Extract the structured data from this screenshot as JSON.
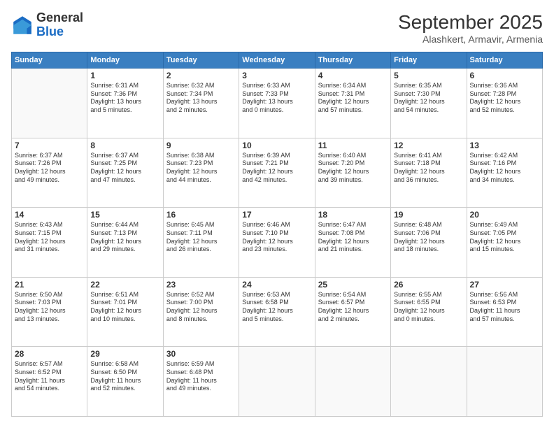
{
  "header": {
    "logo_general": "General",
    "logo_blue": "Blue",
    "month_title": "September 2025",
    "subtitle": "Alashkert, Armavir, Armenia"
  },
  "days_of_week": [
    "Sunday",
    "Monday",
    "Tuesday",
    "Wednesday",
    "Thursday",
    "Friday",
    "Saturday"
  ],
  "weeks": [
    [
      {
        "day": "",
        "info": ""
      },
      {
        "day": "1",
        "info": "Sunrise: 6:31 AM\nSunset: 7:36 PM\nDaylight: 13 hours\nand 5 minutes."
      },
      {
        "day": "2",
        "info": "Sunrise: 6:32 AM\nSunset: 7:34 PM\nDaylight: 13 hours\nand 2 minutes."
      },
      {
        "day": "3",
        "info": "Sunrise: 6:33 AM\nSunset: 7:33 PM\nDaylight: 13 hours\nand 0 minutes."
      },
      {
        "day": "4",
        "info": "Sunrise: 6:34 AM\nSunset: 7:31 PM\nDaylight: 12 hours\nand 57 minutes."
      },
      {
        "day": "5",
        "info": "Sunrise: 6:35 AM\nSunset: 7:30 PM\nDaylight: 12 hours\nand 54 minutes."
      },
      {
        "day": "6",
        "info": "Sunrise: 6:36 AM\nSunset: 7:28 PM\nDaylight: 12 hours\nand 52 minutes."
      }
    ],
    [
      {
        "day": "7",
        "info": "Sunrise: 6:37 AM\nSunset: 7:26 PM\nDaylight: 12 hours\nand 49 minutes."
      },
      {
        "day": "8",
        "info": "Sunrise: 6:37 AM\nSunset: 7:25 PM\nDaylight: 12 hours\nand 47 minutes."
      },
      {
        "day": "9",
        "info": "Sunrise: 6:38 AM\nSunset: 7:23 PM\nDaylight: 12 hours\nand 44 minutes."
      },
      {
        "day": "10",
        "info": "Sunrise: 6:39 AM\nSunset: 7:21 PM\nDaylight: 12 hours\nand 42 minutes."
      },
      {
        "day": "11",
        "info": "Sunrise: 6:40 AM\nSunset: 7:20 PM\nDaylight: 12 hours\nand 39 minutes."
      },
      {
        "day": "12",
        "info": "Sunrise: 6:41 AM\nSunset: 7:18 PM\nDaylight: 12 hours\nand 36 minutes."
      },
      {
        "day": "13",
        "info": "Sunrise: 6:42 AM\nSunset: 7:16 PM\nDaylight: 12 hours\nand 34 minutes."
      }
    ],
    [
      {
        "day": "14",
        "info": "Sunrise: 6:43 AM\nSunset: 7:15 PM\nDaylight: 12 hours\nand 31 minutes."
      },
      {
        "day": "15",
        "info": "Sunrise: 6:44 AM\nSunset: 7:13 PM\nDaylight: 12 hours\nand 29 minutes."
      },
      {
        "day": "16",
        "info": "Sunrise: 6:45 AM\nSunset: 7:11 PM\nDaylight: 12 hours\nand 26 minutes."
      },
      {
        "day": "17",
        "info": "Sunrise: 6:46 AM\nSunset: 7:10 PM\nDaylight: 12 hours\nand 23 minutes."
      },
      {
        "day": "18",
        "info": "Sunrise: 6:47 AM\nSunset: 7:08 PM\nDaylight: 12 hours\nand 21 minutes."
      },
      {
        "day": "19",
        "info": "Sunrise: 6:48 AM\nSunset: 7:06 PM\nDaylight: 12 hours\nand 18 minutes."
      },
      {
        "day": "20",
        "info": "Sunrise: 6:49 AM\nSunset: 7:05 PM\nDaylight: 12 hours\nand 15 minutes."
      }
    ],
    [
      {
        "day": "21",
        "info": "Sunrise: 6:50 AM\nSunset: 7:03 PM\nDaylight: 12 hours\nand 13 minutes."
      },
      {
        "day": "22",
        "info": "Sunrise: 6:51 AM\nSunset: 7:01 PM\nDaylight: 12 hours\nand 10 minutes."
      },
      {
        "day": "23",
        "info": "Sunrise: 6:52 AM\nSunset: 7:00 PM\nDaylight: 12 hours\nand 8 minutes."
      },
      {
        "day": "24",
        "info": "Sunrise: 6:53 AM\nSunset: 6:58 PM\nDaylight: 12 hours\nand 5 minutes."
      },
      {
        "day": "25",
        "info": "Sunrise: 6:54 AM\nSunset: 6:57 PM\nDaylight: 12 hours\nand 2 minutes."
      },
      {
        "day": "26",
        "info": "Sunrise: 6:55 AM\nSunset: 6:55 PM\nDaylight: 12 hours\nand 0 minutes."
      },
      {
        "day": "27",
        "info": "Sunrise: 6:56 AM\nSunset: 6:53 PM\nDaylight: 11 hours\nand 57 minutes."
      }
    ],
    [
      {
        "day": "28",
        "info": "Sunrise: 6:57 AM\nSunset: 6:52 PM\nDaylight: 11 hours\nand 54 minutes."
      },
      {
        "day": "29",
        "info": "Sunrise: 6:58 AM\nSunset: 6:50 PM\nDaylight: 11 hours\nand 52 minutes."
      },
      {
        "day": "30",
        "info": "Sunrise: 6:59 AM\nSunset: 6:48 PM\nDaylight: 11 hours\nand 49 minutes."
      },
      {
        "day": "",
        "info": ""
      },
      {
        "day": "",
        "info": ""
      },
      {
        "day": "",
        "info": ""
      },
      {
        "day": "",
        "info": ""
      }
    ]
  ]
}
